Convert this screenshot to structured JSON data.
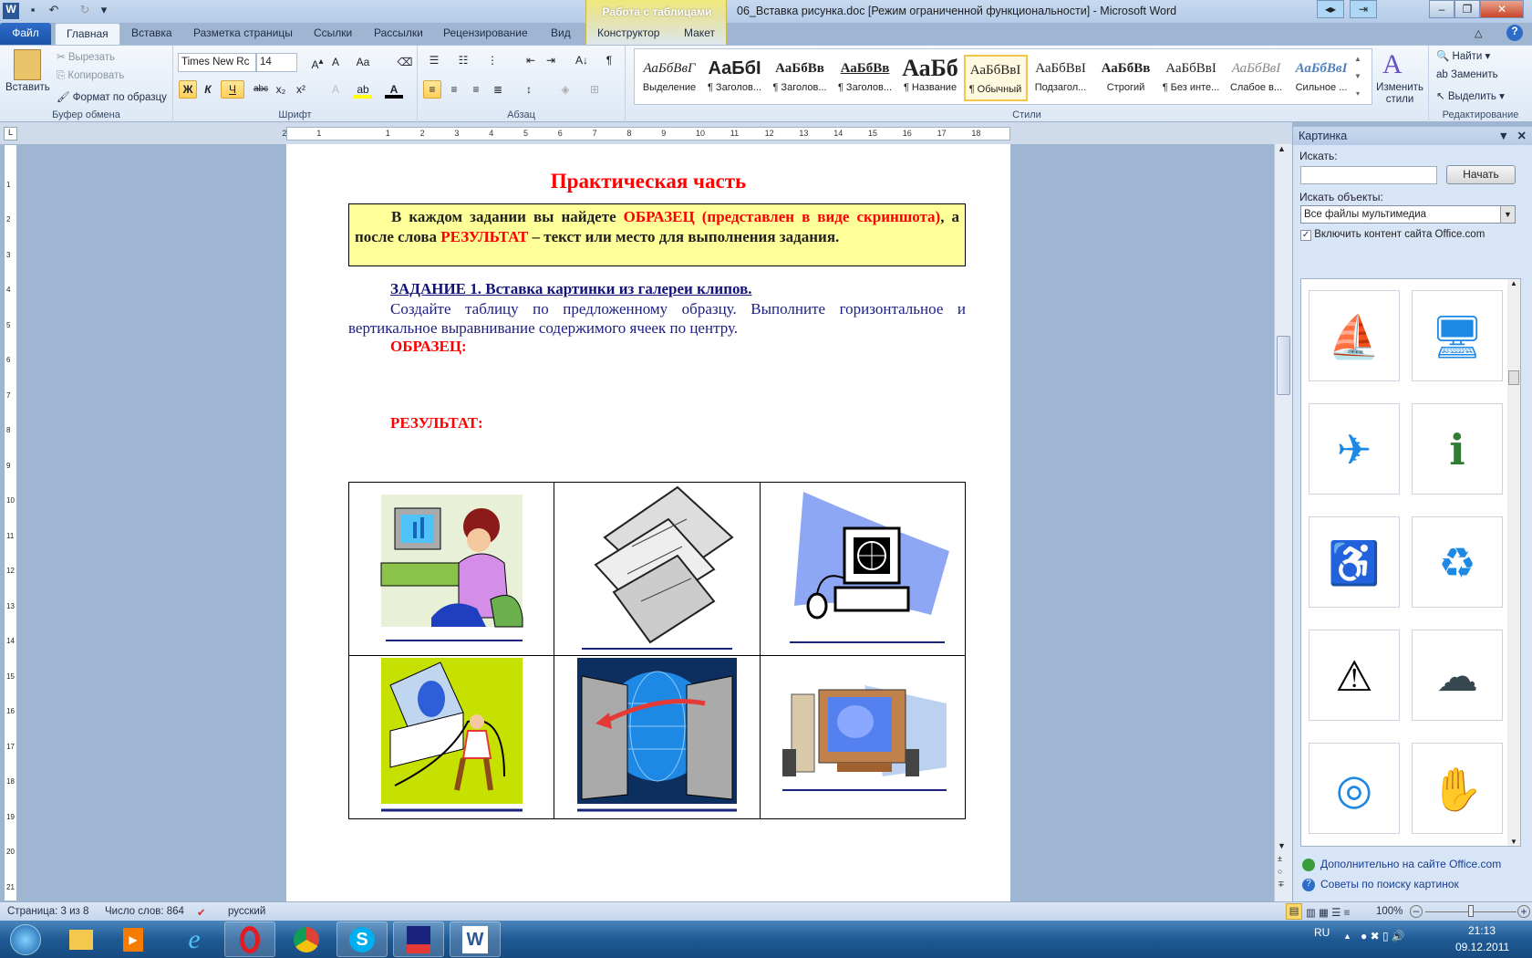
{
  "window": {
    "title": "06_Вставка рисунка.doc [Режим ограниченной функциональности]  -  Microsoft Word",
    "context_tab_group": "Работа с таблицами"
  },
  "tabs": [
    "Файл",
    "Главная",
    "Вставка",
    "Разметка страницы",
    "Ссылки",
    "Рассылки",
    "Рецензирование",
    "Вид",
    "Конструктор",
    "Макет"
  ],
  "ribbon": {
    "clipboard": {
      "paste": "Вставить",
      "cut": "Вырезать",
      "copy": "Копировать",
      "format_painter": "Формат по образцу",
      "label": "Буфер обмена"
    },
    "font": {
      "name": "Times New Rc",
      "size": "14",
      "bold": "Ж",
      "italic": "К",
      "underline": "Ч",
      "label": "Шрифт"
    },
    "paragraph": {
      "label": "Абзац"
    },
    "styles": {
      "label": "Стили",
      "items": [
        {
          "sample": "АаБбВвГ",
          "name": "Выделение"
        },
        {
          "sample": "АаБбІ",
          "name": "¶ Заголов..."
        },
        {
          "sample": "АаБбВв",
          "name": "¶ Заголов..."
        },
        {
          "sample": "АаБбВв",
          "name": "¶ Заголов..."
        },
        {
          "sample": "АаБб",
          "name": "¶ Название"
        },
        {
          "sample": "АаБбВвІ",
          "name": "¶ Обычный"
        },
        {
          "sample": "АаБбВвІ",
          "name": "Подзагол..."
        },
        {
          "sample": "АаБбВв",
          "name": "Строгий"
        },
        {
          "sample": "АаБбВвІ",
          "name": "¶ Без инте..."
        },
        {
          "sample": "АаБбВвІ",
          "name": "Слабое в..."
        },
        {
          "sample": "АаБбВвІ",
          "name": "Сильное ..."
        }
      ],
      "selected": "¶ Обычный",
      "change_styles": "Изменить стили"
    },
    "editing": {
      "find": "Найти",
      "replace": "Заменить",
      "select": "Выделить",
      "label": "Редактирование"
    }
  },
  "document": {
    "title": "Практическая часть",
    "note": {
      "p1": "В каждом задании вы найдете ",
      "p2": "ОБРАЗЕЦ (представлен в виде скриншота)",
      "p3": ", а  после слова ",
      "p4": "РЕЗУЛЬТАТ",
      "p5": " – текст или место для выполнения задания."
    },
    "task_heading": "ЗАДАНИЕ 1.  Вставка картинки из галереи клипов.",
    "task_text": "Создайте таблицу по предложенному образцу. Выполните горизонтальное и вертикальное выравнивание содержимого ячеек по центру.",
    "sample_label": "ОБРАЗЕЦ:",
    "result_label": "РЕЗУЛЬТАТ:",
    "table_cells": [
      "woman-at-computer-clipart",
      "floppy-disks-clipart",
      "globe-computer-clipart",
      "computer-user-clipart",
      "network-globe-clipart",
      "desktop-pc-clipart"
    ]
  },
  "clipart_pane": {
    "title": "Картинка",
    "search_label": "Искать:",
    "search_value": "",
    "go_button": "Начать",
    "search_in_label": "Искать объекты:",
    "media_type": "Все файлы мультимедиа",
    "include_office": "Включить контент сайта Office.com",
    "include_office_checked": true,
    "thumbnails": [
      "sailboat",
      "computer",
      "airplane-sign",
      "info-sign",
      "wheelchair-sign",
      "recycle-sign",
      "construction-sign",
      "rain-cloud",
      "target",
      "hand-card"
    ],
    "more_link": "Дополнительно на сайте Office.com",
    "tips_link": "Советы по поиску картинок"
  },
  "status": {
    "page": "Страница: 3 из 8",
    "words": "Число слов: 864",
    "language": "русский",
    "zoom": "100%",
    "zoom_percent": 100
  },
  "taskbar": {
    "lang": "RU",
    "time": "21:13",
    "date": "09.12.2011"
  }
}
